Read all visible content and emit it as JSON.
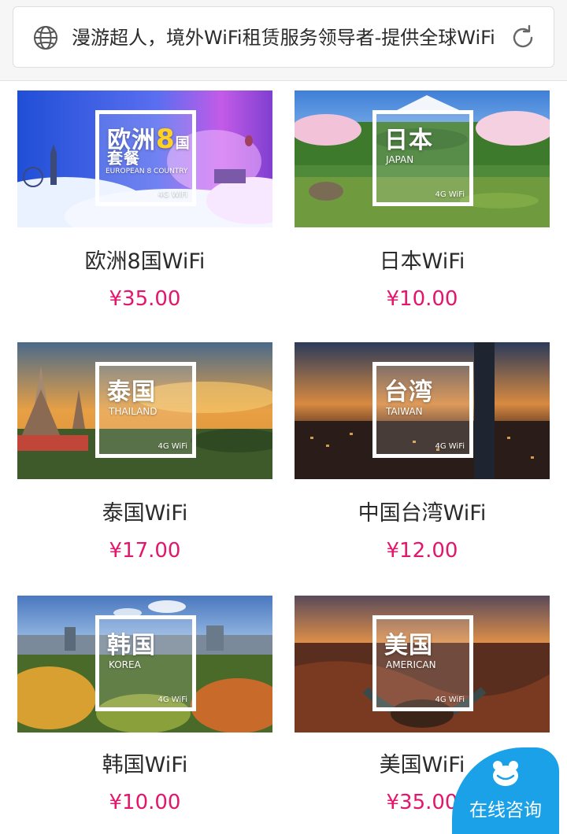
{
  "browser": {
    "title": "漫游超人，境外WiFi租赁服务领导者-提供全球WiFi"
  },
  "products": [
    {
      "name": "欧洲8国WiFi",
      "price": "¥35.00",
      "image_title": "欧洲",
      "image_title_number": "8",
      "image_title_suffix": "国",
      "image_subtitle_zh": "套餐",
      "image_subtitle_en": "EUROPEAN 8 COUNTRY",
      "badge": "4G WiFi"
    },
    {
      "name": "日本WiFi",
      "price": "¥10.00",
      "image_title": "日本",
      "image_subtitle_en": "JAPAN",
      "badge": "4G WiFi"
    },
    {
      "name": "泰国WiFi",
      "price": "¥17.00",
      "image_title": "泰国",
      "image_subtitle_en": "THAILAND",
      "badge": "4G WiFi"
    },
    {
      "name": "中国台湾WiFi",
      "price": "¥12.00",
      "image_title": "台湾",
      "image_subtitle_en": "TAIWAN",
      "badge": "4G WiFi"
    },
    {
      "name": "韩国WiFi",
      "price": "¥10.00",
      "image_title": "韩国",
      "image_subtitle_en": "KOREA",
      "badge": "4G WiFi"
    },
    {
      "name": "美国WiFi",
      "price": "¥35.00",
      "image_title": "美国",
      "image_subtitle_en": "AMERICAN",
      "badge": "4G WiFi"
    }
  ],
  "consult": {
    "label": "在线咨询"
  },
  "colors": {
    "price": "#e4156b",
    "consult_bg": "#1aa1e8"
  },
  "icons": {
    "globe": "globe-icon",
    "reload": "reload-icon",
    "chat": "chat-bear-icon"
  }
}
